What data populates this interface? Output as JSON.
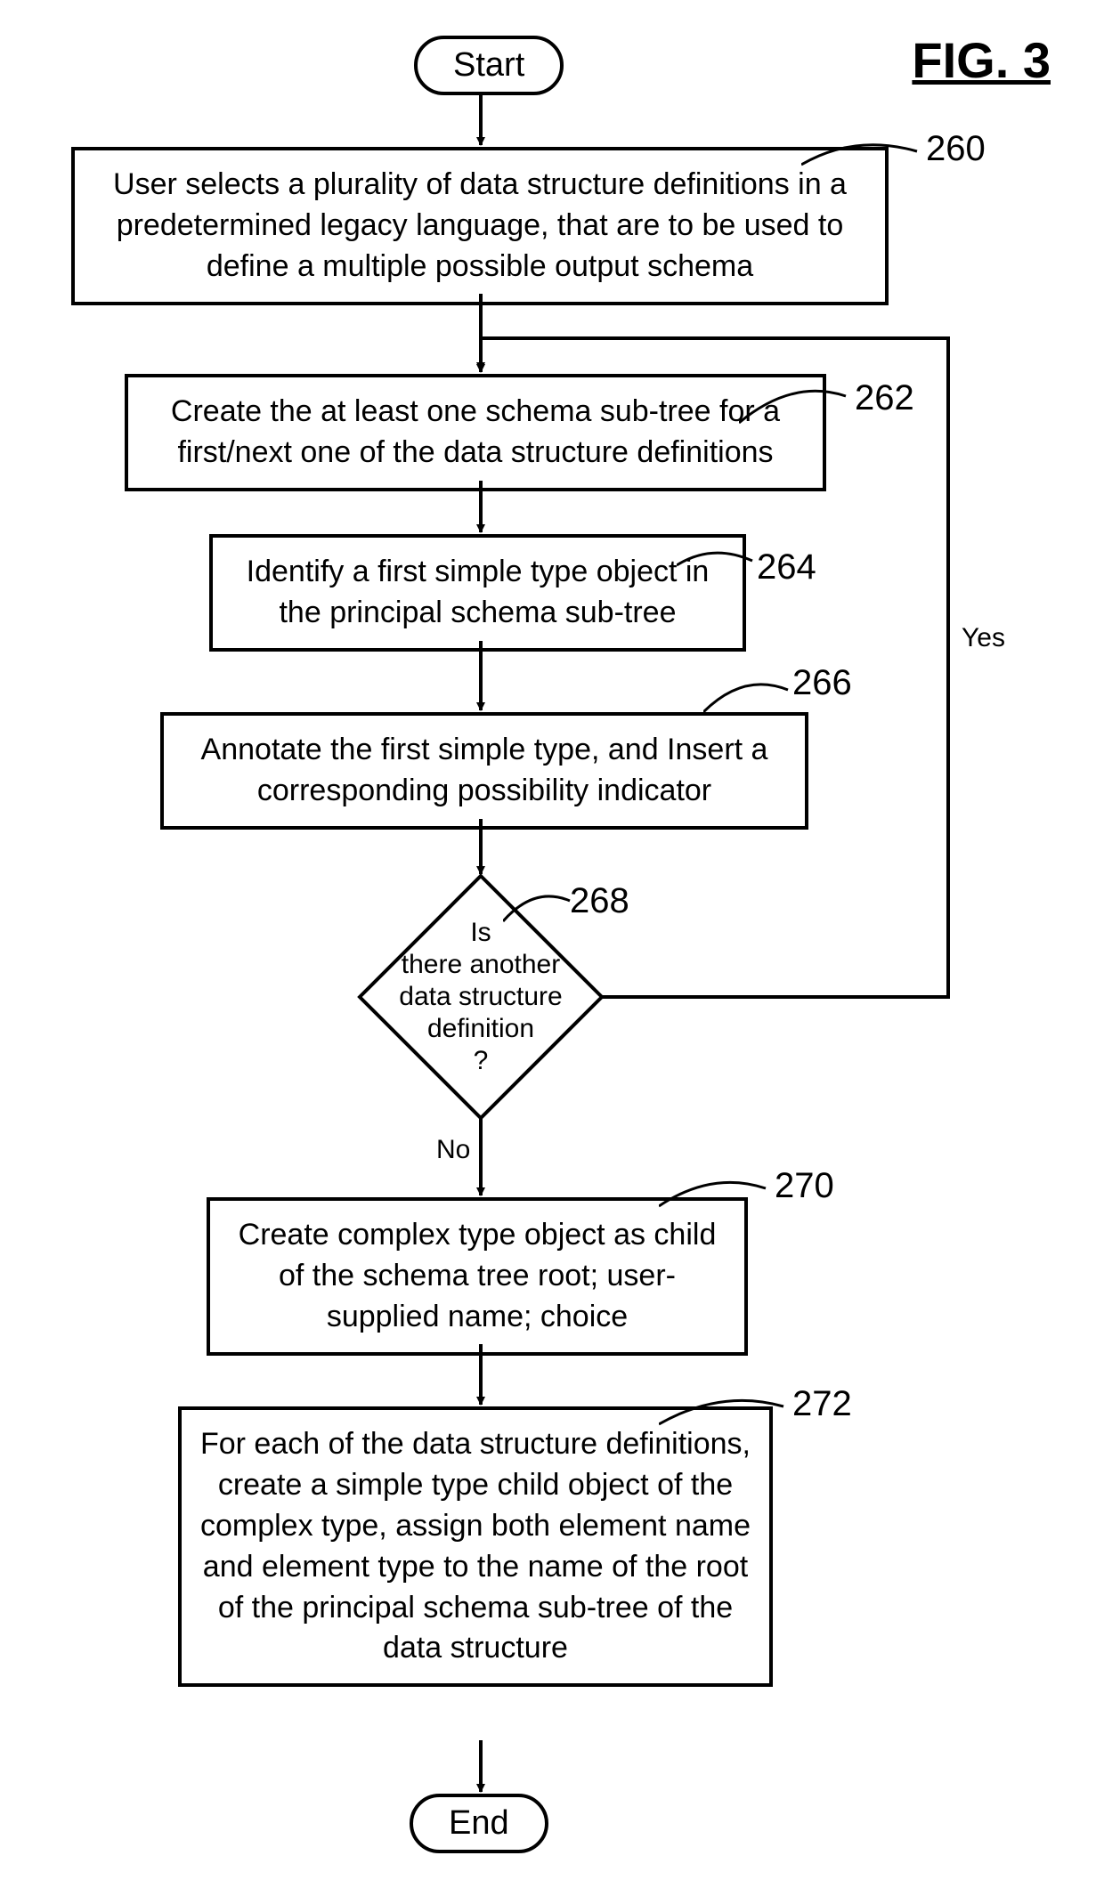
{
  "figure_title": "FIG. 3",
  "terminators": {
    "start": "Start",
    "end": "End"
  },
  "steps": {
    "s260": "User selects a plurality of data structure definitions in a predetermined legacy language, that are to be used to define a multiple possible output schema",
    "s262": "Create the at least one schema sub-tree for a first/next one of the data structure definitions",
    "s264": "Identify a first simple type object in the principal schema sub-tree",
    "s266": "Annotate the first simple type, and Insert a corresponding possibility indicator",
    "s270": "Create complex type object as child of the schema tree root; user-supplied name; choice",
    "s272": "For each of the data structure definitions, create a simple type child object of the complex type, assign both element name and element type to the name of the root of the principal schema sub-tree of the data structure"
  },
  "decision": {
    "d268": "Is\nthere another\ndata structure\ndefinition\n?"
  },
  "refs": {
    "r260": "260",
    "r262": "262",
    "r264": "264",
    "r266": "266",
    "r268": "268",
    "r270": "270",
    "r272": "272"
  },
  "edge_labels": {
    "yes": "Yes",
    "no": "No"
  }
}
